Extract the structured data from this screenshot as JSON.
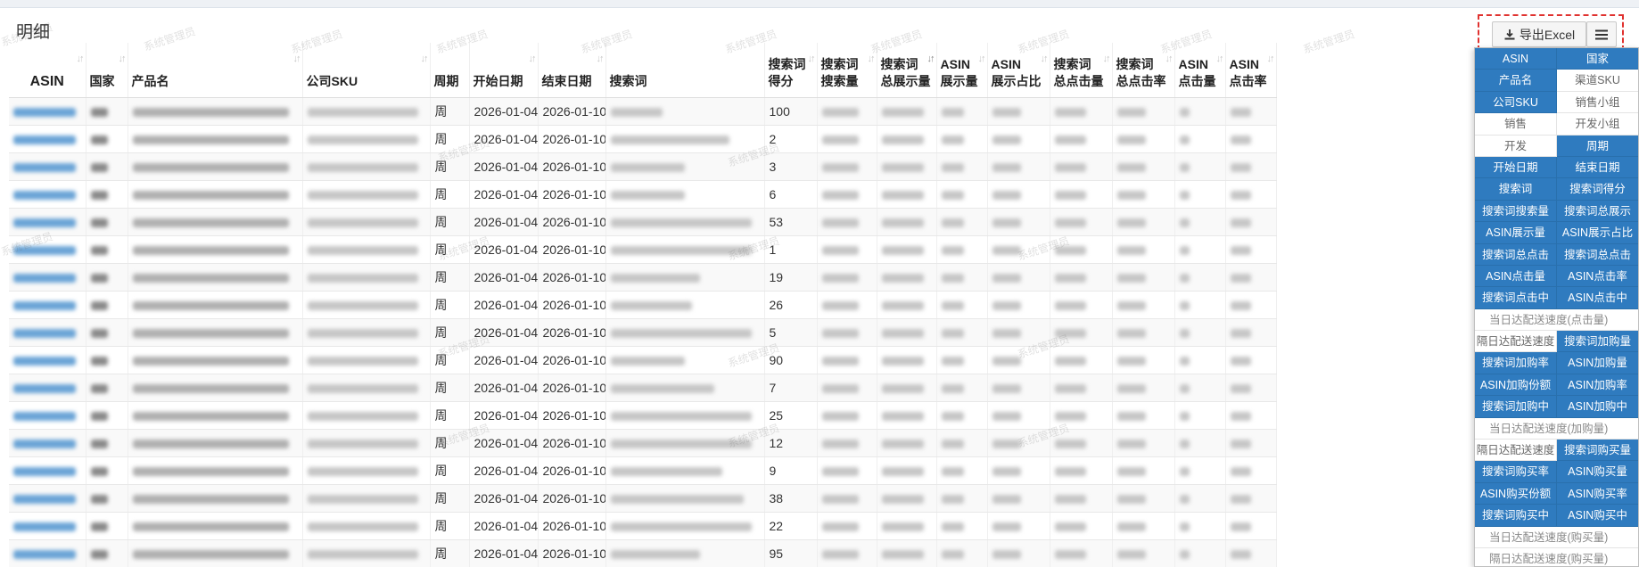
{
  "panel": {
    "title": "明细"
  },
  "toolbar": {
    "export_label": "导出Excel"
  },
  "watermark": "系统管理员",
  "table": {
    "columns": [
      {
        "key": "asin",
        "label": "ASIN"
      },
      {
        "key": "country",
        "label": "国家"
      },
      {
        "key": "product",
        "label": "产品名"
      },
      {
        "key": "sku",
        "label": "公司SKU"
      },
      {
        "key": "period",
        "label": "周期"
      },
      {
        "key": "start",
        "label": "开始日期"
      },
      {
        "key": "end",
        "label": "结束日期"
      },
      {
        "key": "term",
        "label": "搜索词"
      },
      {
        "key": "score",
        "label": "搜索词得分"
      },
      {
        "key": "sq",
        "label": "搜索词搜索量"
      },
      {
        "key": "imp",
        "label": "搜索词总展示量"
      },
      {
        "key": "aimp",
        "label": "ASIN展示量"
      },
      {
        "key": "ashare",
        "label": "ASIN展示占比"
      },
      {
        "key": "clk",
        "label": "搜索词总点击量"
      },
      {
        "key": "ctr",
        "label": "搜索词总点击率"
      },
      {
        "key": "aclk",
        "label": "ASIN点击量"
      },
      {
        "key": "actr",
        "label": "ASIN点击率"
      }
    ],
    "header_lines": {
      "asin": [
        "ASIN"
      ],
      "country": [
        "国家"
      ],
      "product": [
        "产品名"
      ],
      "sku": [
        "公司SKU"
      ],
      "period": [
        "周期"
      ],
      "start": [
        "开始日期"
      ],
      "end": [
        "结束日期"
      ],
      "term": [
        "搜索词"
      ],
      "score": [
        "搜索词",
        "得分"
      ],
      "sq": [
        "搜索词",
        "搜索量"
      ],
      "imp": [
        "搜索词",
        "总展示量"
      ],
      "aimp": [
        "ASIN",
        "展示量"
      ],
      "ashare": [
        "ASIN",
        "展示占比"
      ],
      "clk": [
        "搜索词",
        "总点击量"
      ],
      "ctr": [
        "搜索词",
        "总点击率"
      ],
      "aclk": [
        "ASIN",
        "点击量"
      ],
      "actr": [
        "ASIN",
        "点击率"
      ]
    },
    "rows": [
      {
        "period": "周",
        "start": "2026-01-04",
        "end": "2026-01-10",
        "score": "100"
      },
      {
        "period": "周",
        "start": "2026-01-04",
        "end": "2026-01-10",
        "score": "2"
      },
      {
        "period": "周",
        "start": "2026-01-04",
        "end": "2026-01-10",
        "score": "3"
      },
      {
        "period": "周",
        "start": "2026-01-04",
        "end": "2026-01-10",
        "score": "6"
      },
      {
        "period": "周",
        "start": "2026-01-04",
        "end": "2026-01-10",
        "score": "53"
      },
      {
        "period": "周",
        "start": "2026-01-04",
        "end": "2026-01-10",
        "score": "1"
      },
      {
        "period": "周",
        "start": "2026-01-04",
        "end": "2026-01-10",
        "score": "19"
      },
      {
        "period": "周",
        "start": "2026-01-04",
        "end": "2026-01-10",
        "score": "26"
      },
      {
        "period": "周",
        "start": "2026-01-04",
        "end": "2026-01-10",
        "score": "5"
      },
      {
        "period": "周",
        "start": "2026-01-04",
        "end": "2026-01-10",
        "score": "90"
      },
      {
        "period": "周",
        "start": "2026-01-04",
        "end": "2026-01-10",
        "score": "7"
      },
      {
        "period": "周",
        "start": "2026-01-04",
        "end": "2026-01-10",
        "score": "25"
      },
      {
        "period": "周",
        "start": "2026-01-04",
        "end": "2026-01-10",
        "score": "12"
      },
      {
        "period": "周",
        "start": "2026-01-04",
        "end": "2026-01-10",
        "score": "9"
      },
      {
        "period": "周",
        "start": "2026-01-04",
        "end": "2026-01-10",
        "score": "38"
      },
      {
        "period": "周",
        "start": "2026-01-04",
        "end": "2026-01-10",
        "score": "22"
      },
      {
        "period": "周",
        "start": "2026-01-04",
        "end": "2026-01-10",
        "score": "95"
      }
    ]
  },
  "column_picker": {
    "items": [
      {
        "label": "ASIN",
        "on": true
      },
      {
        "label": "国家",
        "on": true
      },
      {
        "label": "产品名",
        "on": true
      },
      {
        "label": "渠道SKU",
        "on": false
      },
      {
        "label": "公司SKU",
        "on": true
      },
      {
        "label": "销售小组",
        "on": false
      },
      {
        "label": "销售",
        "on": false
      },
      {
        "label": "开发小组",
        "on": false
      },
      {
        "label": "开发",
        "on": false
      },
      {
        "label": "周期",
        "on": true
      },
      {
        "label": "开始日期",
        "on": true
      },
      {
        "label": "结束日期",
        "on": true
      },
      {
        "label": "搜索词",
        "on": true
      },
      {
        "label": "搜索词得分",
        "on": true
      },
      {
        "label": "搜索词搜索量",
        "on": true
      },
      {
        "label": "搜索词总展示",
        "on": true
      },
      {
        "label": "ASIN展示量",
        "on": true
      },
      {
        "label": "ASIN展示占比",
        "on": true
      },
      {
        "label": "搜索词总点击",
        "on": true
      },
      {
        "label": "搜索词总点击",
        "on": true
      },
      {
        "label": "ASIN点击量",
        "on": true
      },
      {
        "label": "ASIN点击率",
        "on": true
      },
      {
        "label": "搜索词点击中",
        "on": true
      },
      {
        "label": "ASIN点击中",
        "on": true
      },
      {
        "label": "当日达配送速度(点击量)",
        "on": false,
        "wide": true
      },
      {
        "label": "隔日达配送速度",
        "on": false
      },
      {
        "label": "搜索词加购量",
        "on": true
      },
      {
        "label": "搜索词加购率",
        "on": true
      },
      {
        "label": "ASIN加购量",
        "on": true
      },
      {
        "label": "ASIN加购份额",
        "on": true
      },
      {
        "label": "ASIN加购率",
        "on": true
      },
      {
        "label": "搜索词加购中",
        "on": true
      },
      {
        "label": "ASIN加购中",
        "on": true
      },
      {
        "label": "当日达配送速度(加购量)",
        "on": false,
        "wide": true
      },
      {
        "label": "隔日达配送速度",
        "on": false
      },
      {
        "label": "搜索词购买量",
        "on": true
      },
      {
        "label": "搜索词购买率",
        "on": true
      },
      {
        "label": "ASIN购买量",
        "on": true
      },
      {
        "label": "ASIN购买份额",
        "on": true
      },
      {
        "label": "ASIN购买率",
        "on": true
      },
      {
        "label": "搜索词购买中",
        "on": true
      },
      {
        "label": "ASIN购买中",
        "on": true
      },
      {
        "label": "当日达配送速度(购买量)",
        "on": false,
        "wide": true
      },
      {
        "label": "隔日达配送速度(购买量)",
        "on": false,
        "wide": true
      }
    ]
  },
  "colors": {
    "accent": "#2f7bbf",
    "highlight": "#e0322f"
  },
  "icons": {
    "export": "download-icon",
    "menu": "hamburger-icon",
    "sort": "sort-arrows-icon"
  }
}
